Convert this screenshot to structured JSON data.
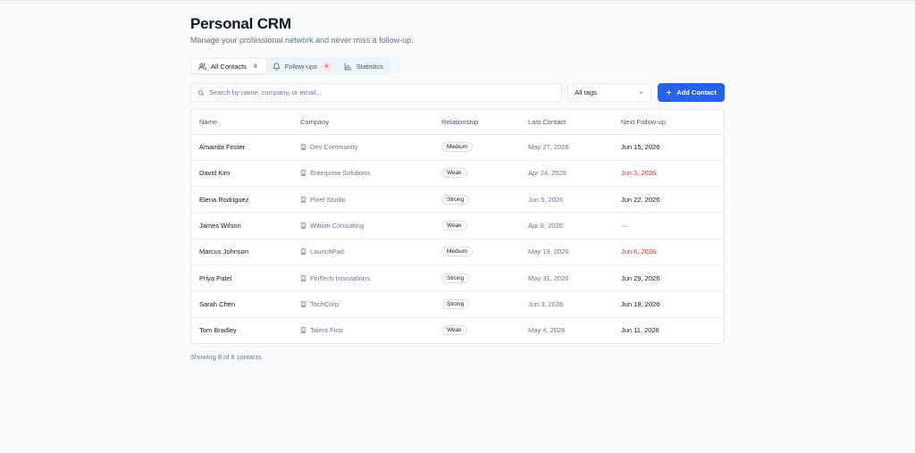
{
  "app": {
    "title": "Personal CRM",
    "subtitle": "Manage your professional network and never miss a follow-up."
  },
  "tabs": [
    {
      "label": "All Contacts",
      "count": "8",
      "icon": "users-icon",
      "active": true
    },
    {
      "label": "Follow-ups",
      "count": "4",
      "icon": "bell-icon",
      "active": false
    },
    {
      "label": "Statistics",
      "count": "",
      "icon": "bar-chart-icon",
      "active": false
    }
  ],
  "search": {
    "placeholder": "Search by name, company, or email...",
    "value": ""
  },
  "filter": {
    "selected": "All tags"
  },
  "add_button": {
    "label": "Add Contact"
  },
  "table": {
    "headers": [
      "Name",
      "Company",
      "Relationship",
      "Last Contact",
      "Next Follow-up"
    ],
    "rows": [
      {
        "name": "Amanda Foster",
        "company": "Dev Community",
        "relationship": "Medium",
        "last_contact": "May 27, 2026",
        "next_followup": "Jun 15, 2026",
        "overdue": false
      },
      {
        "name": "David Kim",
        "company": "Enterprise Solutions",
        "relationship": "Weak",
        "last_contact": "Apr 24, 2026",
        "next_followup": "Jun 3, 2026",
        "overdue": true
      },
      {
        "name": "Elena Rodriguez",
        "company": "Pixel Studio",
        "relationship": "Strong",
        "last_contact": "Jun 5, 2026",
        "next_followup": "Jun 22, 2026",
        "overdue": false
      },
      {
        "name": "James Wilson",
        "company": "Wilson Consulting",
        "relationship": "Weak",
        "last_contact": "Apr 9, 2026",
        "next_followup": "—",
        "overdue": false
      },
      {
        "name": "Marcus Johnson",
        "company": "LaunchPad",
        "relationship": "Medium",
        "last_contact": "May 19, 2026",
        "next_followup": "Jun 6, 2026",
        "overdue": true
      },
      {
        "name": "Priya Patel",
        "company": "FinTech Innovations",
        "relationship": "Strong",
        "last_contact": "May 31, 2026",
        "next_followup": "Jun 29, 2026",
        "overdue": false
      },
      {
        "name": "Sarah Chen",
        "company": "TechCorp",
        "relationship": "Strong",
        "last_contact": "Jun 3, 2026",
        "next_followup": "Jun 18, 2026",
        "overdue": false
      },
      {
        "name": "Tom Bradley",
        "company": "Talent First",
        "relationship": "Weak",
        "last_contact": "May 4, 2026",
        "next_followup": "Jun 11, 2026",
        "overdue": false
      }
    ]
  },
  "footer": {
    "text": "Showing 8 of 8 contacts"
  },
  "colors": {
    "primary": "#2563eb",
    "overdue": "#dc2626",
    "muted": "#64748b",
    "background": "#f8fafc"
  }
}
